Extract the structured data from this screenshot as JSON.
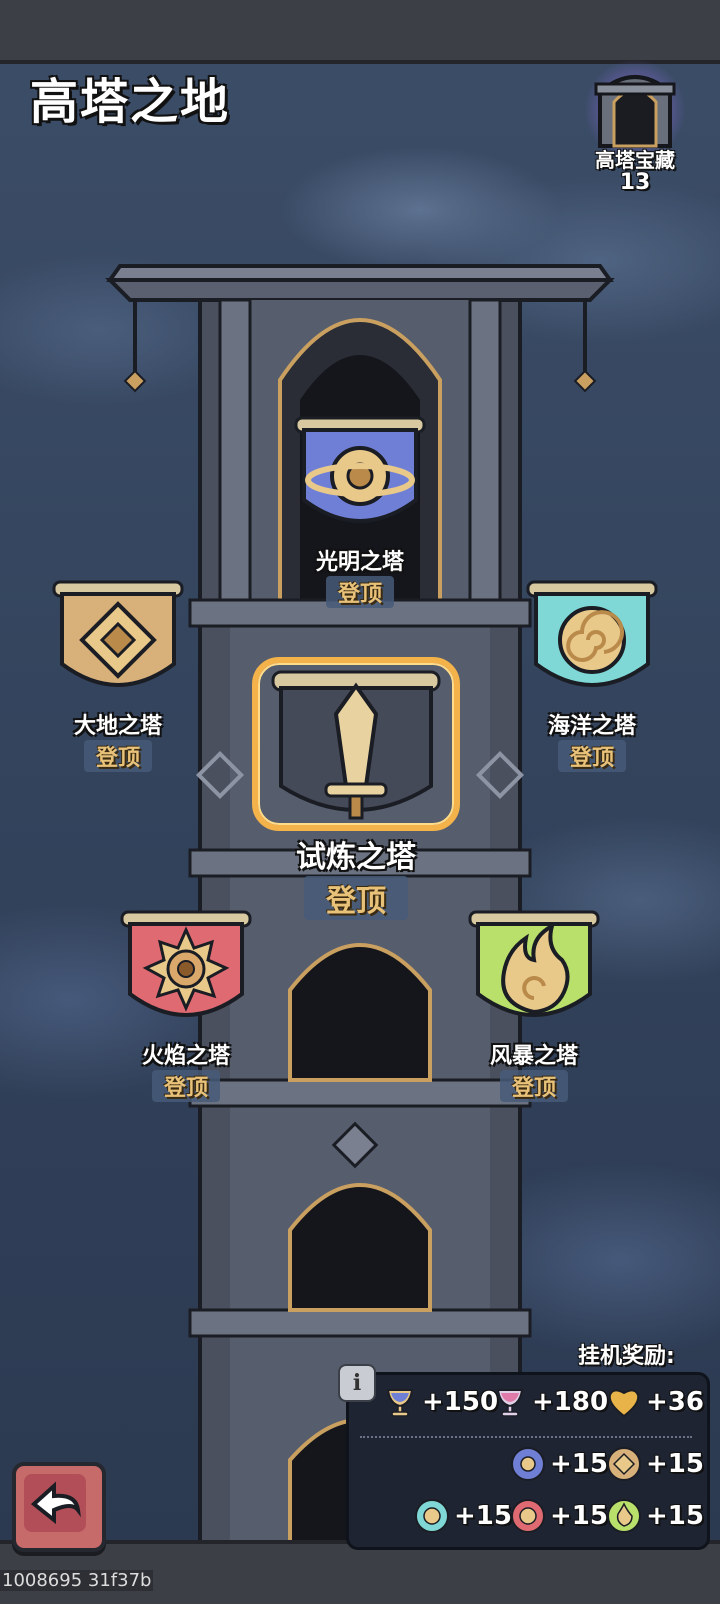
{
  "header": {
    "title": "高塔之地"
  },
  "treasure": {
    "label": "高塔宝藏",
    "count": "13",
    "icon": "tower-gate-icon"
  },
  "towers": [
    {
      "name": "光明之塔",
      "action": "登顶",
      "color": "#6f7fd6",
      "emblem": "light-orb-icon"
    },
    {
      "name": "大地之塔",
      "action": "登顶",
      "color": "#d8b07a",
      "emblem": "earth-crystal-icon"
    },
    {
      "name": "海洋之塔",
      "action": "登顶",
      "color": "#7fd8d6",
      "emblem": "ocean-spiral-icon"
    },
    {
      "name": "试炼之塔",
      "action": "登顶",
      "color": "#c9a05a",
      "emblem": "sword-icon"
    },
    {
      "name": "火焰之塔",
      "action": "登顶",
      "color": "#e06a72",
      "emblem": "fire-sun-icon"
    },
    {
      "name": "风暴之塔",
      "action": "登顶",
      "color": "#b8e06a",
      "emblem": "storm-flame-icon"
    }
  ],
  "idle_rewards": {
    "title": "挂机奖励:",
    "items": [
      {
        "icon": "blue-chalice-icon",
        "value": "+150"
      },
      {
        "icon": "pink-chalice-icon",
        "value": "+180"
      },
      {
        "icon": "gold-heart-icon",
        "value": "+36"
      },
      {
        "icon": "light-token-icon",
        "value": "+15"
      },
      {
        "icon": "earth-token-icon",
        "value": "+15"
      },
      {
        "icon": "ocean-token-icon",
        "value": "+15"
      },
      {
        "icon": "fire-token-icon",
        "value": "+15"
      },
      {
        "icon": "storm-token-icon",
        "value": "+15"
      }
    ]
  },
  "footer": {
    "watermark": "1008695 31f37b"
  }
}
